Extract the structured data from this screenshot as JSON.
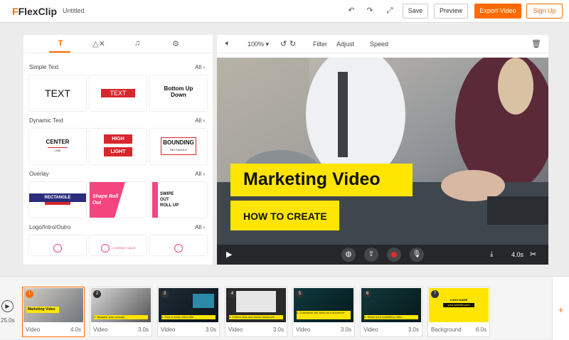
{
  "app": {
    "logo_text": "FlexClip",
    "doc_title": "Untitled"
  },
  "toolbar": {
    "save": "Save",
    "preview": "Preview",
    "export": "Export Video",
    "signup": "Sign Up"
  },
  "library": {
    "tabs": [
      "text-icon",
      "elements-icon",
      "music-icon",
      "settings-icon"
    ],
    "sections": {
      "simple": {
        "title": "Simple Text",
        "all": "All"
      },
      "dynamic": {
        "title": "Dynamic Text",
        "all": "All"
      },
      "overlay": {
        "title": "Overlay",
        "all": "All"
      },
      "logo": {
        "title": "Logo/Intro/Outro",
        "all": "All"
      }
    },
    "cards": {
      "text": "TEXT",
      "text_red": "TEXT",
      "bottom_up": "Bottom Up Down",
      "center": "CENTER",
      "center_sub": "LINE",
      "high": "HIGH",
      "light": "LIGHT",
      "bounding": "BOUNDING",
      "bounding_sub": "RECTANGLE",
      "rectangle": "RECTANGLE",
      "shape_roll": "Shape Roll Out",
      "swipe": "SWIPE OUT ROLL UP",
      "company": "COMPANY NAME"
    }
  },
  "preview": {
    "zoom": "100%",
    "filter": "Filter",
    "adjust": "Adjust",
    "speed": "Speed",
    "headline": "Marketing Video",
    "subhead": "HOW TO CREATE",
    "duration": "4.0s"
  },
  "timeline": {
    "total": "25.0s",
    "clips": [
      {
        "num": "1",
        "type": "Video",
        "dur": "4.0s",
        "caption": "Marketing Video"
      },
      {
        "num": "2",
        "type": "Video",
        "dur": "3.0s",
        "caption": "2. Request your concept"
      },
      {
        "num": "3",
        "type": "Video",
        "dur": "3.0s",
        "caption": "3. Find a music video title"
      },
      {
        "num": "4",
        "type": "Video",
        "dur": "3.0s",
        "caption": "4. Collect clips and music resources"
      },
      {
        "num": "5",
        "type": "Video",
        "dur": "3.0s",
        "caption": "5. Customize the video as it should be"
      },
      {
        "num": "6",
        "type": "Video",
        "dur": "3.0s",
        "caption": "6. Share your marketing video"
      },
      {
        "num": "7",
        "type": "Background",
        "dur": "6.0s",
        "caption": "LOGO NAME"
      }
    ],
    "end_caption": "your website.com"
  },
  "colors": {
    "accent": "#ff6a00",
    "caption_yellow": "#ffe500",
    "card_red": "#d7262c",
    "pink": "#f4457f"
  }
}
